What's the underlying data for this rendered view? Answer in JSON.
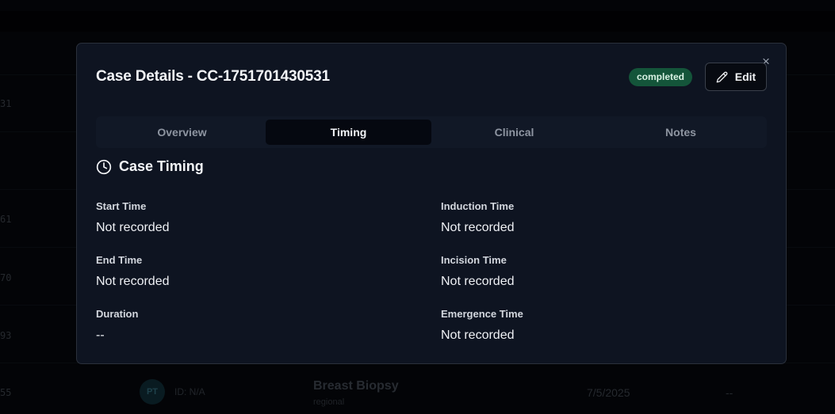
{
  "background": {
    "rows": [
      {
        "id": "31",
        "avatar": "",
        "patient_id": "",
        "procedure": "",
        "anesthesia": "",
        "date": "",
        "duration": ""
      },
      {
        "id": "",
        "avatar": "",
        "patient_id": "",
        "procedure": "",
        "anesthesia": "",
        "date": "",
        "duration": ""
      },
      {
        "id": "61",
        "avatar": "",
        "patient_id": "",
        "procedure": "",
        "anesthesia": "",
        "date": "",
        "duration": ""
      },
      {
        "id": "70",
        "avatar": "",
        "patient_id": "",
        "procedure": "",
        "anesthesia": "",
        "date": "",
        "duration": ""
      },
      {
        "id": "93",
        "avatar": "",
        "patient_id": "",
        "procedure": "",
        "anesthesia": "",
        "date": "",
        "duration": ""
      },
      {
        "id": "55",
        "avatar": "PT",
        "patient_id": "ID: N/A",
        "procedure": "Breast Biopsy",
        "anesthesia": "regional",
        "date": "7/5/2025",
        "duration": "--"
      }
    ]
  },
  "modal": {
    "title": "Case Details - CC-1751701430531",
    "status_badge": "completed",
    "edit_label": "Edit",
    "close_glyph": "×",
    "tabs": [
      {
        "label": "Overview",
        "active": false
      },
      {
        "label": "Timing",
        "active": true
      },
      {
        "label": "Clinical",
        "active": false
      },
      {
        "label": "Notes",
        "active": false
      }
    ],
    "section_title": "Case Timing",
    "section_icon": "clock-icon",
    "fields": {
      "start_time": {
        "label": "Start Time",
        "value": "Not recorded"
      },
      "end_time": {
        "label": "End Time",
        "value": "Not recorded"
      },
      "duration": {
        "label": "Duration",
        "value": "--"
      },
      "induction_time": {
        "label": "Induction Time",
        "value": "Not recorded"
      },
      "incision_time": {
        "label": "Incision Time",
        "value": "Not recorded"
      },
      "emergence_time": {
        "label": "Emergence Time",
        "value": "Not recorded"
      }
    }
  },
  "colors": {
    "badge_bg": "#14553a",
    "modal_bg": "#0e1421",
    "page_bg": "#05070b"
  }
}
